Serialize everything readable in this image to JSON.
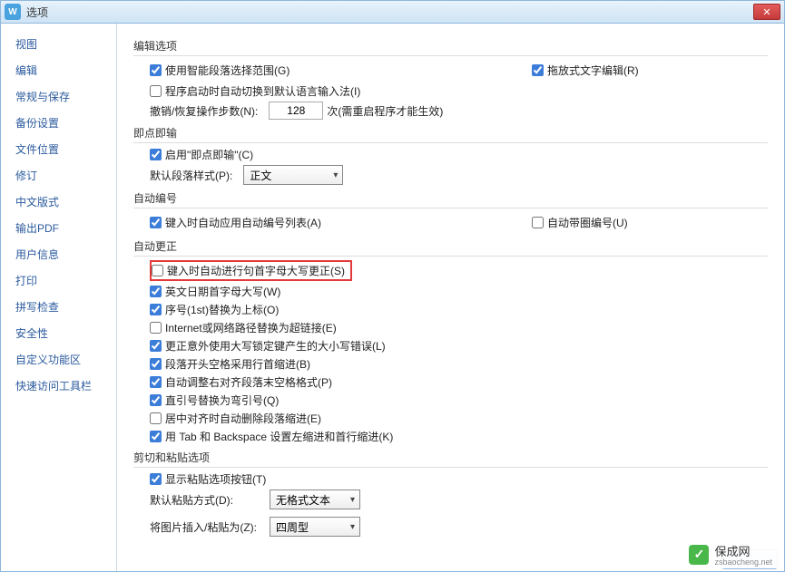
{
  "window": {
    "title": "选项"
  },
  "sidebar": {
    "items": [
      {
        "label": "视图"
      },
      {
        "label": "编辑"
      },
      {
        "label": "常规与保存"
      },
      {
        "label": "备份设置"
      },
      {
        "label": "文件位置"
      },
      {
        "label": "修订"
      },
      {
        "label": "中文版式"
      },
      {
        "label": "输出PDF"
      },
      {
        "label": "用户信息"
      },
      {
        "label": "打印"
      },
      {
        "label": "拼写检查"
      },
      {
        "label": "安全性"
      },
      {
        "label": "自定义功能区"
      },
      {
        "label": "快速访问工具栏"
      }
    ],
    "selected_index": 1
  },
  "groups": {
    "edit_options": {
      "title": "编辑选项",
      "smart_paragraph": "使用智能段落选择范围(G)",
      "drag_text": "拖放式文字编辑(R)",
      "ime_switch": "程序启动时自动切换到默认语言输入法(I)",
      "undo_label": "撤销/恢复操作步数(N):",
      "undo_value": "128",
      "undo_suffix": "次(需重启程序才能生效)"
    },
    "instant_input": {
      "title": "即点即输",
      "enable": "启用\"即点即输\"(C)",
      "default_style_label": "默认段落样式(P):",
      "default_style_value": "正文"
    },
    "auto_number": {
      "title": "自动编号",
      "apply_list": "键入时自动应用自动编号列表(A)",
      "circle_number": "自动带圈编号(U)"
    },
    "auto_correct": {
      "title": "自动更正",
      "capitalize_sentence": "键入时自动进行句首字母大写更正(S)",
      "english_date": "英文日期首字母大写(W)",
      "ordinal": "序号(1st)替换为上标(O)",
      "hyperlink": "Internet或网络路径替换为超链接(E)",
      "caps_lock": "更正意外使用大写锁定键产生的大小写错误(L)",
      "first_indent": "段落开头空格采用行首缩进(B)",
      "align_space": "自动调整右对齐段落末空格格式(P)",
      "quotes": "直引号替换为弯引号(Q)",
      "center_indent": "居中对齐时自动删除段落缩进(E)",
      "tab_backspace": "用 Tab 和 Backspace 设置左缩进和首行缩进(K)"
    },
    "cut_paste": {
      "title": "剪切和粘贴选项",
      "show_paste_btn": "显示粘贴选项按钮(T)",
      "default_paste_label": "默认粘贴方式(D):",
      "default_paste_value": "无格式文本",
      "image_paste_label": "将图片插入/粘贴为(Z):",
      "image_paste_value": "四周型"
    }
  },
  "watermark": {
    "name": "保成网",
    "url": "zsbaocheng.net"
  }
}
